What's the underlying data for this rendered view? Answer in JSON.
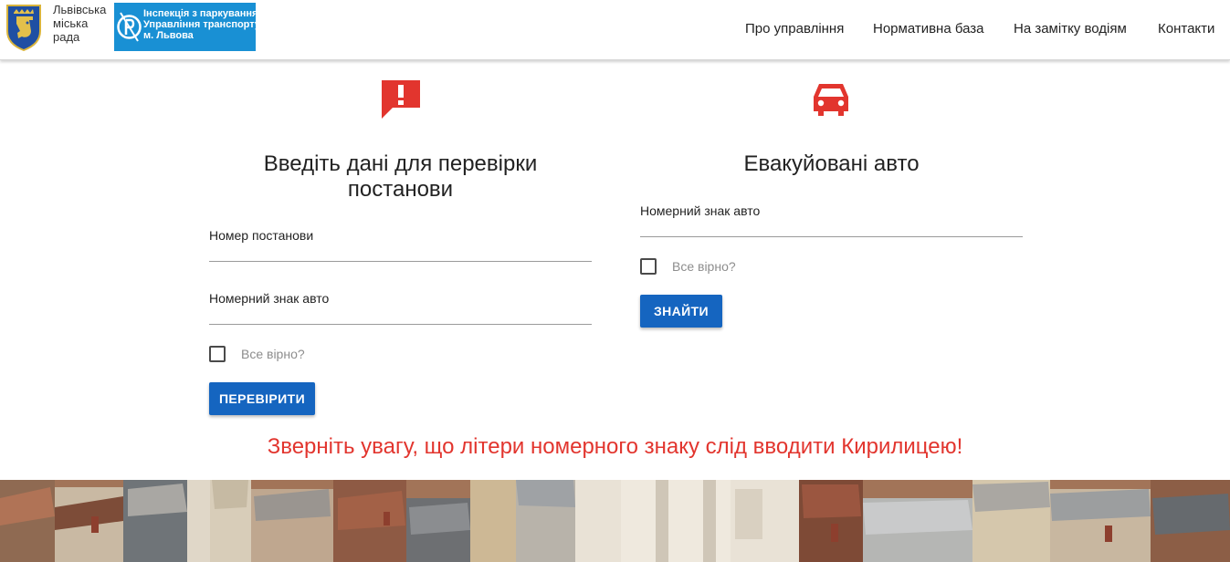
{
  "header": {
    "council_name": [
      "Львівська",
      "міська",
      "рада"
    ],
    "inspection_logo_lines": [
      "Інспекція з паркування",
      "Управління транспорту",
      "м. Львова"
    ],
    "nav": [
      "Про управління",
      "Нормативна база",
      "На замітку водіям",
      "Контакти"
    ]
  },
  "check_form": {
    "icon": "alert-speech-icon",
    "title_line1": "Введіть дані для перевірки",
    "title_line2": "постанови",
    "resolution_number_label": "Номер постанови",
    "resolution_number_value": "",
    "plate_label": "Номерний знак авто",
    "plate_value": "",
    "confirm_label": "Все вірно?",
    "confirm_checked": false,
    "submit_label": "ПЕРЕВІРИТИ"
  },
  "towed_form": {
    "icon": "car-icon",
    "title": "Евакуйовані авто",
    "plate_label": "Номерний знак авто",
    "plate_value": "",
    "confirm_label": "Все вірно?",
    "confirm_checked": false,
    "submit_label": "ЗНАЙТИ"
  },
  "notice": "Зверніть увагу, що літери номерного знаку слід вводити Кирилицею!",
  "colors": {
    "accent_red": "#e2352e",
    "button_blue": "#1565c0",
    "logo_blue": "#1990d4"
  }
}
